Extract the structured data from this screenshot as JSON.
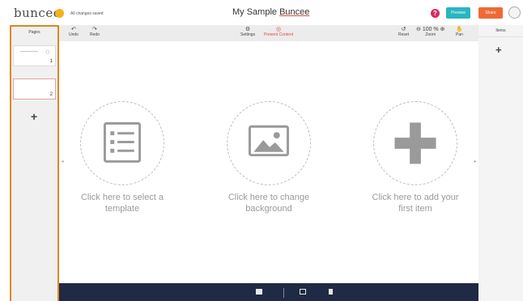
{
  "header": {
    "logo": "buncee",
    "save_status": "All changes saved",
    "title_pre": "My Sample ",
    "title_brand": "Buncee",
    "help_label": "?",
    "preview_label": "Preview",
    "share_label": "Share"
  },
  "pages_panel": {
    "header": "Pages",
    "pages": [
      {
        "number": "1"
      },
      {
        "number": "2"
      }
    ],
    "add_label": "+"
  },
  "toolbar": {
    "undo": "Undo",
    "redo": "Redo",
    "settings": "Settings",
    "present": "Present Content",
    "reset": "Reset",
    "zoom_value": "100 %",
    "zoom": "Zoom",
    "pan": "Pan"
  },
  "items_panel": {
    "header": "Items",
    "add_label": "+"
  },
  "canvas": {
    "actions": [
      {
        "line1": "Click here to select a",
        "line2": "template",
        "icon": "template-list-icon"
      },
      {
        "line1": "Click here to change",
        "line2": "background",
        "icon": "image-icon"
      },
      {
        "line1": "Click here to add your",
        "line2": "first item",
        "icon": "plus-icon"
      }
    ]
  },
  "colors": {
    "accent_orange": "#e08520",
    "preview": "#28b6c0",
    "share": "#ee6a35",
    "bottom_bar": "#1f2a44"
  }
}
